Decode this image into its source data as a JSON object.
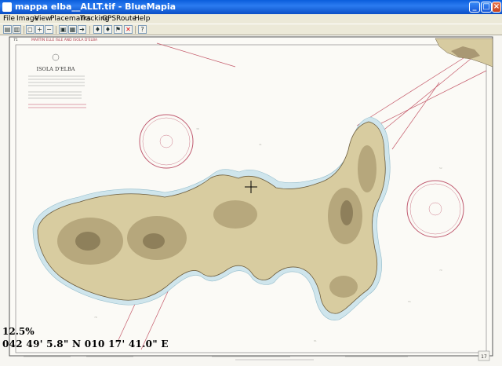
{
  "window": {
    "title": "mappa elba__ALLT.tif - BlueMapia"
  },
  "menu": [
    "File",
    "Image",
    "View",
    "Placemarks",
    "Tracking",
    "GPS",
    "Route",
    "Help"
  ],
  "toolbar": {
    "icons": [
      "open-icon",
      "open-folder-icon",
      "fit-page-icon",
      "zoom-in-icon",
      "zoom-out-icon",
      "save-icon",
      "map-icon",
      "forward-icon",
      "waypoint-add-icon",
      "waypoint-icon",
      "waypoint-flag-icon",
      "delete-icon",
      "info-icon"
    ]
  },
  "map": {
    "chart_title": "ISOLA D'ELBA",
    "header_line": "MARTIN ELLE ISLE AND ISOLA D'ELBA",
    "corner_label": "71",
    "zoom_text": "12.5%",
    "coordinates_text": "042 49' 5.8\" N 010 17' 41.0\" E",
    "footer_page": "17"
  },
  "colors": {
    "sea": "#f7f6f2",
    "shallow": "#cfe5ec",
    "land": "#d8cca0",
    "relief": "#8a7a55",
    "grid": "#a04040"
  }
}
